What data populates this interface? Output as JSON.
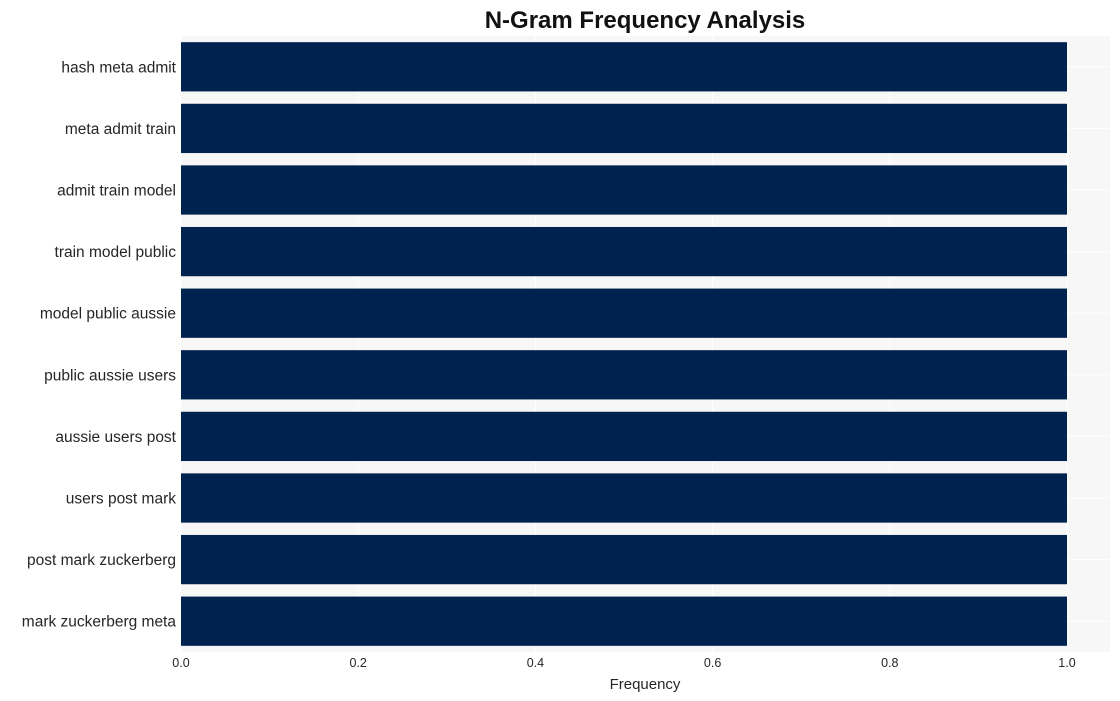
{
  "chart_data": {
    "type": "bar",
    "orientation": "horizontal",
    "title": "N-Gram Frequency Analysis",
    "xlabel": "Frequency",
    "ylabel": "",
    "categories": [
      "hash meta admit",
      "meta admit train",
      "admit train model",
      "train model public",
      "model public aussie",
      "public aussie users",
      "aussie users post",
      "users post mark",
      "post mark zuckerberg",
      "mark zuckerberg meta"
    ],
    "values": [
      1,
      1,
      1,
      1,
      1,
      1,
      1,
      1,
      1,
      1
    ],
    "xlim": [
      0,
      1.05
    ],
    "xticks": [
      "0.0",
      "0.2",
      "0.4",
      "0.6",
      "0.8",
      "1.0"
    ],
    "grid": true,
    "legend": "none",
    "colors": {
      "bar": "#00224e",
      "plot_background": "#f7f7f7",
      "grid": "#ffffff"
    }
  }
}
